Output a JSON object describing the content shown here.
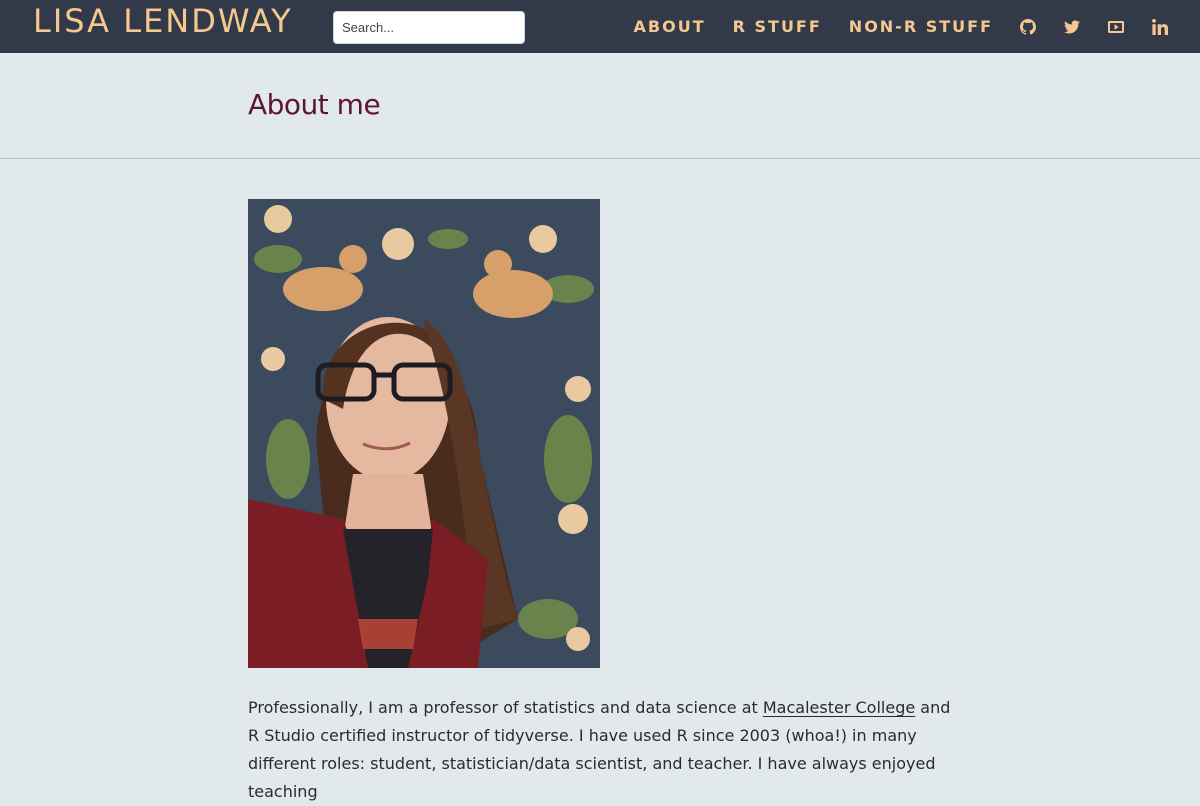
{
  "site": {
    "brand": "LISA LENDWAY",
    "search_placeholder": "Search...",
    "nav": [
      {
        "label": "ABOUT"
      },
      {
        "label": "R STUFF"
      },
      {
        "label": "NON-R STUFF"
      }
    ],
    "social_icons": [
      "github-icon",
      "twitter-icon",
      "youtube-icon",
      "linkedin-icon"
    ]
  },
  "page": {
    "title": "About me",
    "bio_part1": "Professionally, I am a professor of statistics and data science at ",
    "bio_link": "Macalester College",
    "bio_part2": " and R Studio certified instructor of tidyverse. I have used R since 2003 (whoa!) in many different roles: student, statistician/data scientist, and teacher. I have always enjoyed teaching"
  },
  "colors": {
    "navbar_bg": "#323a49",
    "accent": "#f6c88f",
    "title": "#5d1530",
    "page_bg": "#e2e9ec"
  }
}
